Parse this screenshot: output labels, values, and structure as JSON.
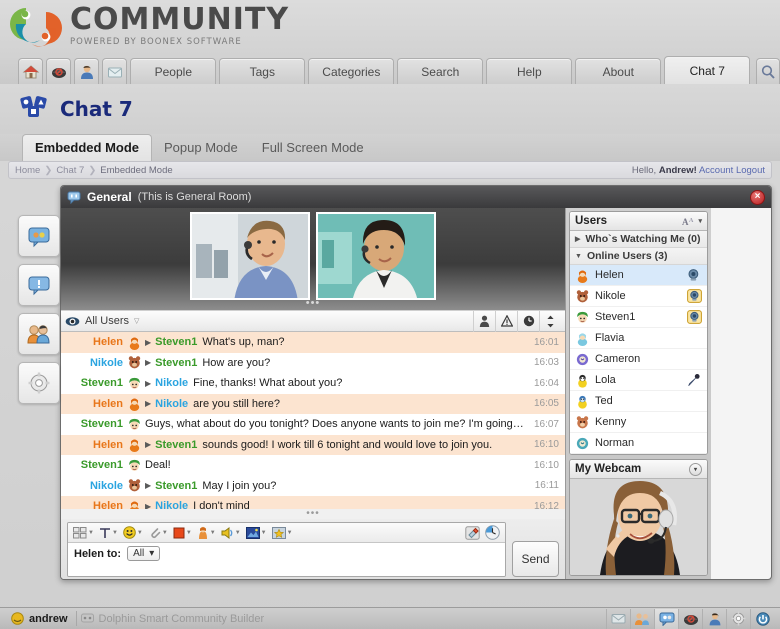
{
  "brand": {
    "name": "COMMUNITY",
    "tagline": "POWERED BY BOONEX SOFTWARE"
  },
  "mainnav": {
    "icons": [
      {
        "name": "home-icon",
        "title": "Home"
      },
      {
        "name": "mail-icon",
        "title": "Mail"
      },
      {
        "name": "profile-icon",
        "title": "Profile"
      },
      {
        "name": "messages-icon",
        "title": "Messages"
      }
    ],
    "items": [
      {
        "label": "People",
        "active": false
      },
      {
        "label": "Tags",
        "active": false
      },
      {
        "label": "Categories",
        "active": false
      },
      {
        "label": "Search",
        "active": false
      },
      {
        "label": "Help",
        "active": false
      },
      {
        "label": "About",
        "active": false
      },
      {
        "label": "Chat 7",
        "active": true
      }
    ],
    "search_icon": "search-icon"
  },
  "page": {
    "title": "Chat 7",
    "icon": "chat-logo-icon"
  },
  "mode_tabs": [
    {
      "label": "Embedded Mode",
      "active": true
    },
    {
      "label": "Popup Mode",
      "active": false
    },
    {
      "label": "Full Screen Mode",
      "active": false
    }
  ],
  "breadcrumb": {
    "items": [
      "Home",
      "Chat 7",
      "Embedded Mode"
    ],
    "hello_prefix": "Hello,",
    "user": "Andrew!",
    "account_label": "Account",
    "logout_label": "Logout"
  },
  "vstrip": [
    {
      "name": "sidebar-rooms-icon",
      "title": "Rooms"
    },
    {
      "name": "sidebar-chat-icon",
      "title": "Chat"
    },
    {
      "name": "sidebar-users-icon",
      "title": "Users"
    },
    {
      "name": "sidebar-settings-icon",
      "title": "Settings"
    }
  ],
  "chat_window": {
    "room_name": "General",
    "room_desc": "(This is General Room)",
    "close_label": "×",
    "grip": "•••",
    "videos": [
      {
        "alt": "Steven1 webcam",
        "name": "video-thumb-1"
      },
      {
        "alt": "Nikole webcam",
        "name": "video-thumb-2"
      }
    ],
    "filter": {
      "eye_icon": "eye-icon",
      "label": "All Users",
      "caret": "▽",
      "actions": [
        {
          "name": "filter-user-icon",
          "glyph": "person"
        },
        {
          "name": "filter-alert-icon",
          "glyph": "alert"
        },
        {
          "name": "filter-time-icon",
          "glyph": "clock"
        },
        {
          "name": "filter-sort-icon",
          "glyph": "sort"
        }
      ]
    },
    "messages": [
      {
        "from": "Helen",
        "from_color": "helen",
        "to": "Steven1",
        "to_color": "steven",
        "text": "What's up, man?",
        "time": "16:01",
        "hl": true,
        "avatar": "helen"
      },
      {
        "from": "Nikole",
        "from_color": "nikole",
        "to": "Steven1",
        "to_color": "steven",
        "text": "How are you?",
        "time": "16:03",
        "hl": false,
        "avatar": "nikole"
      },
      {
        "from": "Steven1",
        "from_color": "steven",
        "to": "Nikole",
        "to_color": "nikole",
        "text": "Fine, thanks! What about you?",
        "time": "16:04",
        "hl": false,
        "avatar": "steven"
      },
      {
        "from": "Helen",
        "from_color": "helen",
        "to": "Nikole",
        "to_color": "nikole",
        "text": "are you still here?",
        "time": "16:05",
        "hl": true,
        "avatar": "helen"
      },
      {
        "from": "Steven1",
        "from_color": "steven",
        "to": "",
        "to_color": "steven",
        "text": "Guys, what about do you tonight? Does anyone wants to join me? I'm going to the  night club!",
        "time": "16:07",
        "hl": false,
        "avatar": "steven"
      },
      {
        "from": "Helen",
        "from_color": "helen",
        "to": "Steven1",
        "to_color": "steven",
        "text": "sounds good! I work till 6 tonight and would love to join you.",
        "time": "16:10",
        "hl": true,
        "avatar": "helen"
      },
      {
        "from": "Steven1",
        "from_color": "steven",
        "to": "",
        "to_color": "steven",
        "text": "Deal!",
        "time": "16:10",
        "hl": false,
        "avatar": "steven"
      },
      {
        "from": "Nikole",
        "from_color": "nikole",
        "to": "Steven1",
        "to_color": "steven",
        "text": "May I join you?",
        "time": "16:11",
        "hl": false,
        "avatar": "nikole"
      },
      {
        "from": "Helen",
        "from_color": "helen",
        "to": "Nikole",
        "to_color": "nikole",
        "text": "I don't mind",
        "time": "16:12",
        "hl": true,
        "avatar": "helen"
      }
    ],
    "messages_grip": "•••",
    "composer": {
      "tools": [
        {
          "name": "layout-tool-icon"
        },
        {
          "name": "text-format-tool-icon"
        },
        {
          "name": "smiley-tool-icon"
        },
        {
          "name": "attachment-tool-icon"
        },
        {
          "name": "color-tool-icon"
        },
        {
          "name": "avatar-tool-icon"
        },
        {
          "name": "sound-tool-icon"
        },
        {
          "name": "image-tool-icon"
        },
        {
          "name": "favorite-tool-icon"
        }
      ],
      "right_tools": [
        {
          "name": "eraser-tool-icon"
        },
        {
          "name": "clock-tool-icon"
        }
      ],
      "sender_label": "Helen to:",
      "recipient_value": "All",
      "recipient_caret": "▾",
      "input_placeholder": "",
      "input_value": "",
      "send_label": "Send"
    }
  },
  "sidebar": {
    "users_panel": {
      "title": "Users",
      "font_icon": "font-size-icon",
      "caret": "▾",
      "groups": [
        {
          "label": "Who`s Watching Me (0)",
          "expanded": false,
          "tri": "▶"
        },
        {
          "label": "Online Users (3)",
          "expanded": true,
          "tri": "▼"
        }
      ],
      "users": [
        {
          "name": "Helen",
          "avatar": "helen",
          "selected": true,
          "badge": "webcam"
        },
        {
          "name": "Nikole",
          "avatar": "nikole",
          "selected": false,
          "badge": "webcam-active"
        },
        {
          "name": "Steven1",
          "avatar": "steven",
          "selected": false,
          "badge": "webcam-active"
        },
        {
          "name": "Flavia",
          "avatar": "flavia",
          "selected": false,
          "badge": ""
        },
        {
          "name": "Cameron",
          "avatar": "cameron",
          "selected": false,
          "badge": ""
        },
        {
          "name": "Lola",
          "avatar": "lola",
          "selected": false,
          "badge": "mic"
        },
        {
          "name": "Ted",
          "avatar": "ted",
          "selected": false,
          "badge": ""
        },
        {
          "name": "Kenny",
          "avatar": "kenny",
          "selected": false,
          "badge": ""
        },
        {
          "name": "Norman",
          "avatar": "norman",
          "selected": false,
          "badge": ""
        }
      ]
    },
    "webcam_panel": {
      "title": "My Webcam",
      "caret": "▾",
      "alt": "My webcam preview"
    }
  },
  "taskbar": {
    "user": "andrew",
    "app_label": "Dolphin Smart Community Builder",
    "icons": [
      {
        "name": "taskbar-mail-icon",
        "active": false
      },
      {
        "name": "taskbar-people-icon",
        "active": false
      },
      {
        "name": "taskbar-chat-icon",
        "active": true
      },
      {
        "name": "taskbar-speed-icon",
        "active": false
      },
      {
        "name": "taskbar-profile-icon",
        "active": false
      },
      {
        "name": "taskbar-settings-icon",
        "active": false
      },
      {
        "name": "taskbar-power-icon",
        "active": false
      }
    ]
  },
  "colors": {
    "brand_green": "#7ab648",
    "brand_blue": "#1a8fa8",
    "brand_orange": "#e2622a",
    "title_blue": "#1a2a7a",
    "highlight_row": "#fce4d0",
    "selected_row": "#d8e9fa",
    "helen": "#e8761a",
    "nikole": "#2aa4e0",
    "steven": "#3a9a2a"
  }
}
